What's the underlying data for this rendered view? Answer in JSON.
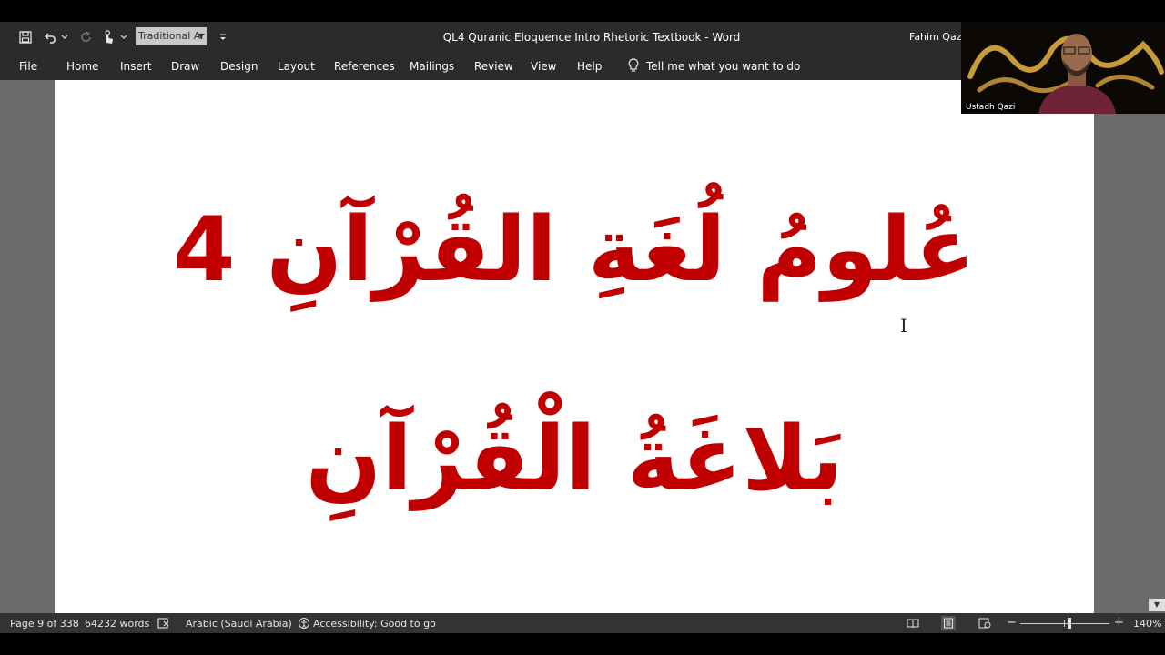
{
  "window": {
    "title": "QL4 Quranic Eloquence Intro Rhetoric Textbook  -  Word",
    "user": "Fahim Qazi"
  },
  "toolbar": {
    "font_name": "Traditional Ar",
    "icons": [
      "save-icon",
      "undo-icon",
      "redo-icon",
      "touch-mode-icon",
      "customize-qat-icon"
    ]
  },
  "ribbon_tabs": [
    "File",
    "Home",
    "Insert",
    "Draw",
    "Design",
    "Layout",
    "References",
    "Mailings",
    "Review",
    "View",
    "Help"
  ],
  "tell_me": "Tell me what you want to do",
  "document": {
    "line1": "عُلومُ لُغَةِ القُرْآنِ 4",
    "line2": "بَلاغَةُ الْقُرْآنِ",
    "text_color": "#c00000"
  },
  "status": {
    "page": "Page 9 of 338",
    "words": "64232 words",
    "language": "Arabic (Saudi Arabia)",
    "accessibility": "Accessibility: Good to go",
    "zoom_minus": "−",
    "zoom_plus": "+",
    "zoom": "140%"
  },
  "webcam": {
    "label": "Ustadh Qazi"
  }
}
